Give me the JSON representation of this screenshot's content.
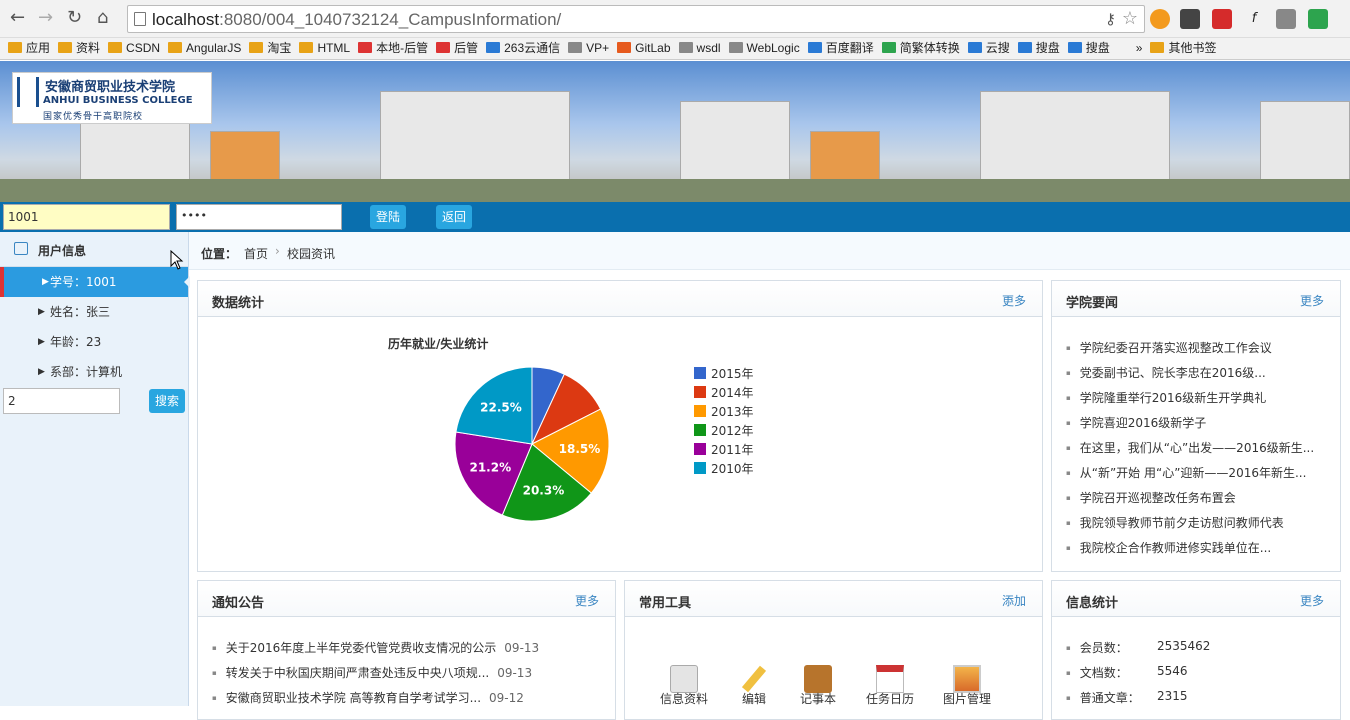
{
  "browser": {
    "url_host": "localhost",
    "url_rest": ":8080/004_1040732124_CampusInformation/",
    "bookmarks": [
      "应用",
      "资料",
      "CSDN",
      "AngularJS",
      "淘宝",
      "HTML",
      "本地-后管",
      "后管",
      "263云通信",
      "VP+",
      "GitLab",
      "wsdl",
      "WebLogic",
      "百度翻译",
      "简繁体转换",
      "云搜",
      "搜盘",
      "搜盘",
      "»",
      "其他书签"
    ]
  },
  "banner": {
    "logo_cn": "安徽商贸职业技术学院",
    "logo_en": "ANHUI BUSINESS COLLEGE",
    "logo_sub": "国家优秀骨干高职院校"
  },
  "login": {
    "user": "1001",
    "password": "••••",
    "login_btn": "登陆",
    "back_btn": "返回"
  },
  "sidebar": {
    "title": "用户信息",
    "items": [
      "学号：1001",
      "姓名：张三",
      "年龄：23",
      "系部：计算机"
    ],
    "search_value": "2",
    "search_btn": "搜索"
  },
  "crumb": {
    "label": "位置：",
    "home": "首页",
    "current": "校园资讯"
  },
  "stats_panel": {
    "title": "数据统计",
    "more": "更多"
  },
  "chart_data": {
    "type": "pie",
    "title": "历年就业/失业统计",
    "categories": [
      "2015年",
      "2014年",
      "2013年",
      "2012年",
      "2011年",
      "2010年"
    ],
    "values": [
      6.9,
      10.6,
      18.5,
      20.3,
      21.2,
      22.5
    ],
    "labels": [
      "",
      "",
      "18.5%",
      "20.3%",
      "21.2%",
      "22.5%"
    ],
    "colors": [
      "#3366cc",
      "#dc3912",
      "#ff9900",
      "#109618",
      "#990099",
      "#0099c6"
    ],
    "legend": "right"
  },
  "news_panel": {
    "title": "学院要闻",
    "more": "更多",
    "items": [
      "学院纪委召开落实巡视整改工作会议",
      "党委副书记、院长李忠在2016级...",
      "学院隆重举行2016级新生开学典礼",
      "学院喜迎2016级新学子",
      "在这里，我们从“心”出发——2016级新生...",
      "从“新”开始 用“心”迎新——2016年新生...",
      "学院召开巡视整改任务布置会",
      "我院领导教师节前夕走访慰问教师代表",
      "我院校企合作教师进修实践单位在..."
    ]
  },
  "notice_panel": {
    "title": "通知公告",
    "more": "更多",
    "items": [
      {
        "text": "关于2016年度上半年党委代管党费收支情况的公示",
        "date": "09-13"
      },
      {
        "text": "转发关于中秋国庆期间严肃查处违反中央八项规...",
        "date": "09-13"
      },
      {
        "text": "安徽商贸职业技术学院 高等教育自学考试学习...",
        "date": "09-12"
      }
    ]
  },
  "tools_panel": {
    "title": "常用工具",
    "more": "添加",
    "items": [
      "信息资料",
      "编辑",
      "记事本",
      "任务日历",
      "图片管理"
    ]
  },
  "info_panel": {
    "title": "信息统计",
    "more": "更多",
    "items": [
      {
        "k": "会员数：",
        "v": "2535462"
      },
      {
        "k": "文档数：",
        "v": "5546"
      },
      {
        "k": "普通文章：",
        "v": "2315"
      }
    ]
  }
}
